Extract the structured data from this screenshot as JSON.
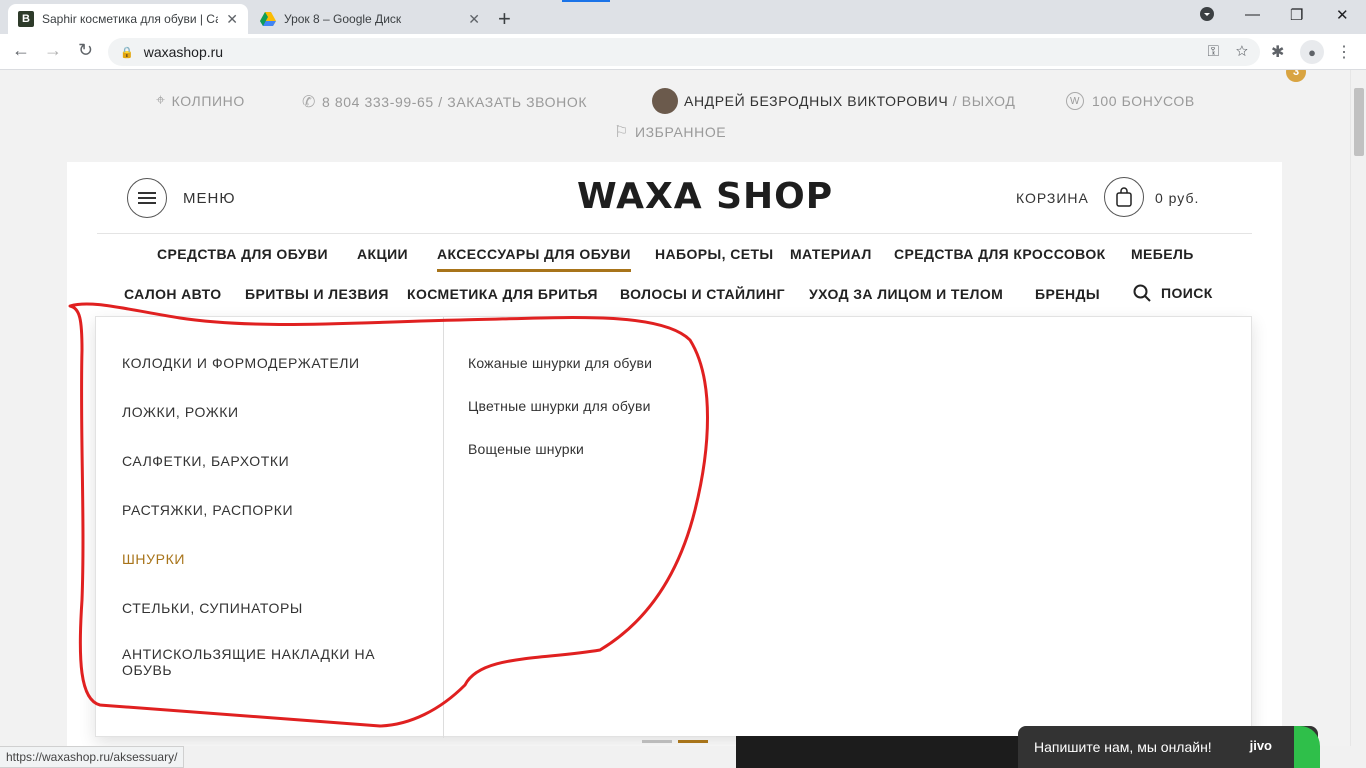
{
  "browser": {
    "tabs": [
      {
        "title": "Saphir косметика для обуви | Са",
        "favicon": "B"
      },
      {
        "title": "Урок 8 – Google Диск",
        "favicon": "drive-icon"
      }
    ],
    "url": "waxashop.ru",
    "status_url": "https://waxashop.ru/aksessuary/"
  },
  "topbar": {
    "city": "КОЛПИНО",
    "phone": "8 804 333-99-65",
    "callback": "/ ЗАКАЗАТЬ ЗВОНОК",
    "user": "АНДРЕЙ БЕЗРОДНЫХ ВИКТОРОВИЧ",
    "logout": "/ ВЫХОД",
    "bonus_badge": "W",
    "bonus": "100 БОНУСОВ",
    "favorites": "ИЗБРАННОЕ",
    "notification_count": "3"
  },
  "header": {
    "menu_label": "МЕНЮ",
    "logo": "WAXA SHOP",
    "cart_label": "КОРЗИНА",
    "cart_sum": "0 руб."
  },
  "nav": {
    "row1": [
      "СРЕДСТВА ДЛЯ ОБУВИ",
      "АКЦИИ",
      "АКСЕССУАРЫ ДЛЯ ОБУВИ",
      "НАБОРЫ, СЕТЫ",
      "МАТЕРИАЛ",
      "СРЕДСТВА ДЛЯ КРОССОВОК",
      "МЕБЕЛЬ"
    ],
    "row2": [
      "САЛОН АВТО",
      "БРИТВЫ И ЛЕЗВИЯ",
      "КОСМЕТИКА ДЛЯ БРИТЬЯ",
      "ВОЛОСЫ И СТАЙЛИНГ",
      "УХОД ЗА ЛИЦОМ И ТЕЛОМ",
      "БРЕНДЫ"
    ],
    "search_label": "ПОИСК"
  },
  "dropdown": {
    "categories": [
      "КОЛОДКИ И ФОРМОДЕРЖАТЕЛИ",
      "ЛОЖКИ, РОЖКИ",
      "САЛФЕТКИ, БАРХОТКИ",
      "РАСТЯЖКИ, РАСПОРКИ",
      "ШНУРКИ",
      "СТЕЛЬКИ, СУПИНАТОРЫ",
      "АНТИСКОЛЬЗЯЩИЕ НАКЛАДКИ НА ОБУВЬ"
    ],
    "subcategories": [
      "Кожаные шнурки для обуви",
      "Цветные шнурки для обуви",
      "Вощеные шнурки"
    ]
  },
  "chat": {
    "label": "Напишите нам, мы онлайн!",
    "brand": "jivo"
  },
  "colors": {
    "accent": "#a8741a",
    "annotation": "#e02020",
    "chat_bg": "#333333",
    "chat_green": "#2fbf4a"
  }
}
